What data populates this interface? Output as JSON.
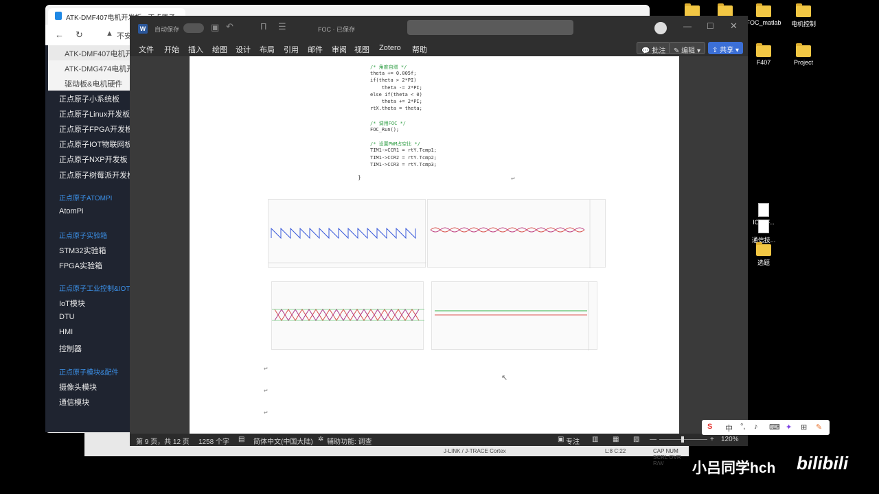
{
  "desktop": {
    "icons": [
      {
        "label": "",
        "type": "folder"
      },
      {
        "label": "",
        "type": "folder"
      },
      {
        "label": "FOC_matlab",
        "type": "folder"
      },
      {
        "label": "电机控制",
        "type": "folder"
      },
      {
        "label": "F407",
        "type": "folder"
      },
      {
        "label": "Project",
        "type": "folder"
      },
      {
        "label": "IO-OF...",
        "type": "file"
      },
      {
        "label": "通信技...",
        "type": "file"
      },
      {
        "label": "选题",
        "type": "folder"
      }
    ]
  },
  "browser": {
    "tab_title": "ATK-DMF407电机开发板 - 正点原子...",
    "address": "不安",
    "sidebar_top": [
      "ATK-DMF407电机开...",
      "ATK-DMG474电机开...",
      "驱动板&电机硬件"
    ],
    "sidebar_items": [
      {
        "kind": "item",
        "label": "正点原子小系统板"
      },
      {
        "kind": "item",
        "label": "正点原子Linux开发板"
      },
      {
        "kind": "item",
        "label": "正点原子FPGA开发板"
      },
      {
        "kind": "item",
        "label": "正点原子IOT物联网板"
      },
      {
        "kind": "item",
        "label": "正点原子NXP开发板"
      },
      {
        "kind": "item",
        "label": "正点原子树莓派开发板"
      },
      {
        "kind": "head",
        "label": "正点原子ATOMPI"
      },
      {
        "kind": "item",
        "label": "AtomPi"
      },
      {
        "kind": "head",
        "label": "正点原子实验箱"
      },
      {
        "kind": "item",
        "label": "STM32实验箱"
      },
      {
        "kind": "item",
        "label": "FPGA实验箱"
      },
      {
        "kind": "head",
        "label": "正点原子工业控制&IOT"
      },
      {
        "kind": "item",
        "label": "IoT模块"
      },
      {
        "kind": "item",
        "label": "DTU"
      },
      {
        "kind": "item",
        "label": "HMI"
      },
      {
        "kind": "item",
        "label": "控制器"
      },
      {
        "kind": "head",
        "label": "正点原子模块&配件"
      },
      {
        "kind": "item",
        "label": "摄像头模块"
      },
      {
        "kind": "item",
        "label": "通信模块"
      }
    ]
  },
  "word": {
    "autosave_label": "自动保存",
    "doc_title": "FOC · 已保存",
    "menu": [
      "文件",
      "开始",
      "插入",
      "绘图",
      "设计",
      "布局",
      "引用",
      "邮件",
      "审阅",
      "视图",
      "Zotero",
      "帮助"
    ],
    "ribbon_buttons": {
      "comment": "批注",
      "edit": "编辑",
      "share": "共享"
    },
    "code_lines": [
      {
        "text": "/* 角度自增 */",
        "comment": true
      },
      {
        "text": "theta += 0.005f;",
        "comment": false
      },
      {
        "text": "if(theta > 2*PI)",
        "comment": false
      },
      {
        "text": "    theta -= 2*PI;",
        "comment": false
      },
      {
        "text": "else if(theta < 0)",
        "comment": false
      },
      {
        "text": "    theta += 2*PI;",
        "comment": false
      },
      {
        "text": "rtX.theta = theta;",
        "comment": false
      },
      {
        "text": "",
        "comment": false
      },
      {
        "text": "/* 调用FOC */",
        "comment": true
      },
      {
        "text": "FOC_Run();",
        "comment": false
      },
      {
        "text": "",
        "comment": false
      },
      {
        "text": "/* 设置PWM占空比 */",
        "comment": true
      },
      {
        "text": "TIM1->CCR1 = rtY.Tcmp1;",
        "comment": false
      },
      {
        "text": "TIM1->CCR2 = rtY.Tcmp2;",
        "comment": false
      },
      {
        "text": "TIM1->CCR3 = rtY.Tcmp3;",
        "comment": false
      }
    ],
    "closing_brace": "}",
    "status": {
      "page": "第 9 页，共 12 页",
      "words": "1258 个字",
      "language": "简体中文(中国大陆)",
      "accessibility": "辅助功能: 调查",
      "focus": "专注",
      "zoom": "120%"
    }
  },
  "keil_status": {
    "debugger": "J-LINK / J-TRACE Cortex",
    "position": "L:8 C:22",
    "flags": "CAP  NUM  SCRL  OVR  R/W"
  },
  "ime": {
    "lang": "中"
  },
  "watermark": {
    "user": "小吕同学hch",
    "site": "bilibili"
  },
  "colors": {
    "word_chrome": "#2f2f2f",
    "share_accent": "#3b6fd6",
    "wave_red": "#d9534f",
    "wave_blue": "#3b5bdb",
    "wave_green": "#2fb344"
  }
}
